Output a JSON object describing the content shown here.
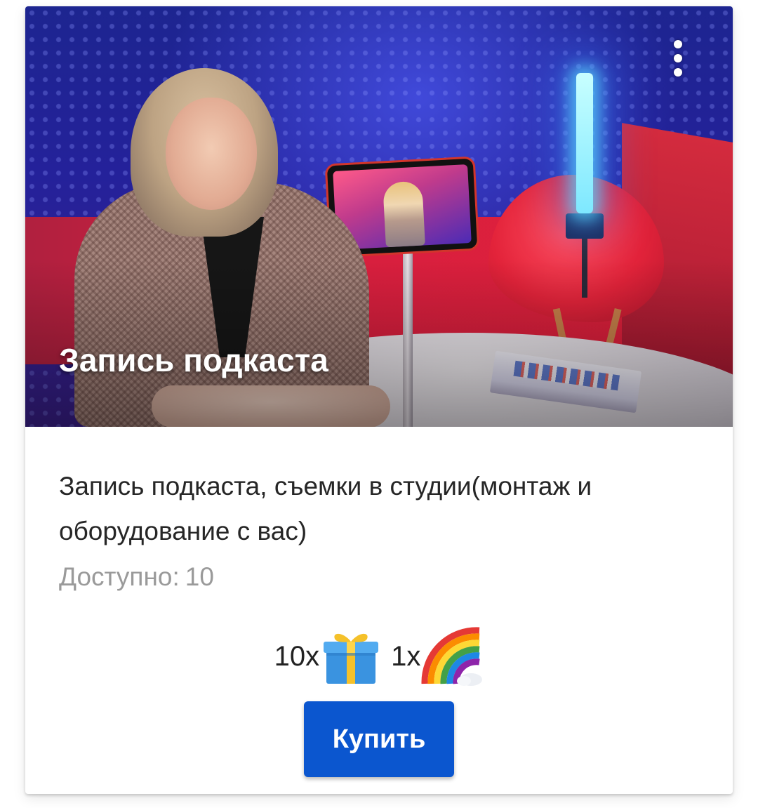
{
  "card": {
    "title": "Запись подкаста",
    "description": "Запись подкаста, съемки в студии(монтаж и оборудование с вас)",
    "availability": {
      "label": "Доступно:",
      "count": "10"
    },
    "prices": [
      {
        "quantity": "10x",
        "icon": "gift-icon"
      },
      {
        "quantity": "1x",
        "icon": "rainbow-icon"
      }
    ],
    "buy_label": "Купить",
    "menu_icon": "more-vertical-icon"
  },
  "colors": {
    "accent": "#0b56cf",
    "title_text": "#ffffff",
    "body_text": "#262626",
    "muted_text": "#9a9a9a",
    "card_background": "#ffffff"
  }
}
